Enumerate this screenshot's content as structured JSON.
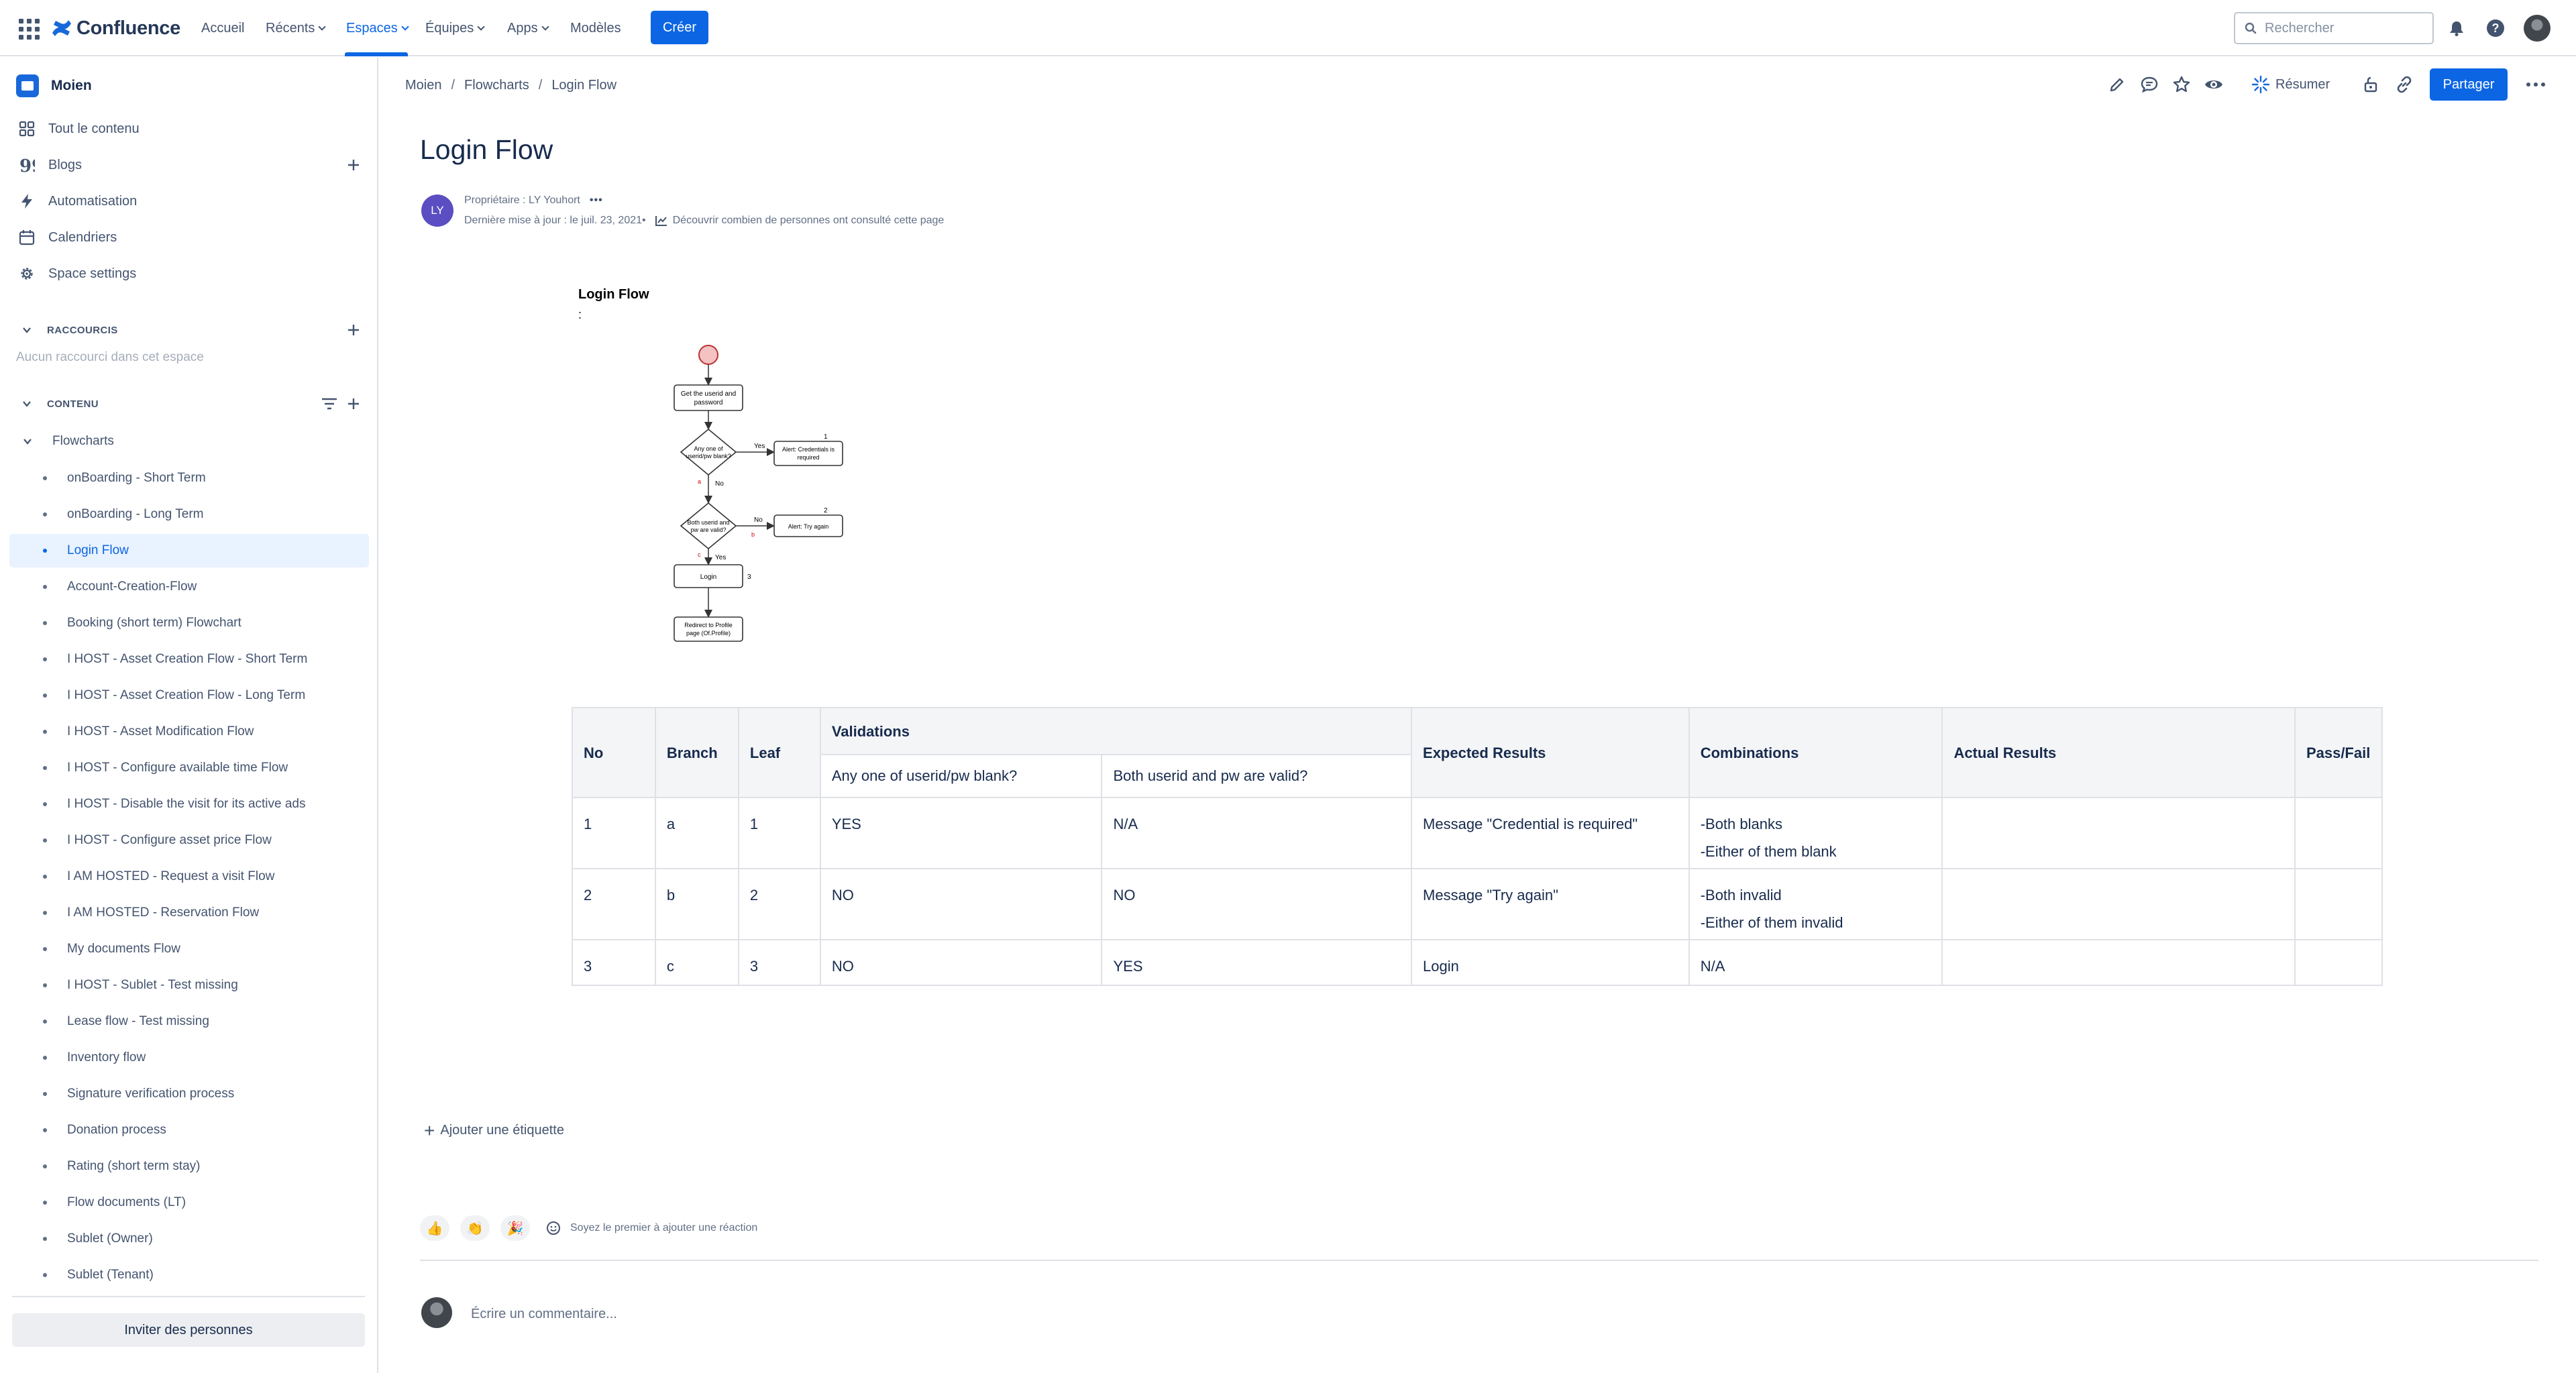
{
  "topnav": {
    "app_name": "Confluence",
    "items": [
      {
        "label": "Accueil",
        "has_chevron": false,
        "active": false
      },
      {
        "label": "Récents",
        "has_chevron": true,
        "active": false
      },
      {
        "label": "Espaces",
        "has_chevron": true,
        "active": true
      },
      {
        "label": "Équipes",
        "has_chevron": true,
        "active": false
      },
      {
        "label": "Apps",
        "has_chevron": true,
        "active": false
      },
      {
        "label": "Modèles",
        "has_chevron": false,
        "active": false
      }
    ],
    "create_label": "Créer",
    "search_placeholder": "Rechercher",
    "icons": [
      "app-switcher-icon",
      "notifications-icon",
      "help-icon",
      "profile-avatar"
    ]
  },
  "sidebar": {
    "space_name": "Moien",
    "links": [
      {
        "label": "Tout le contenu",
        "icon": "all-content-icon"
      },
      {
        "label": "Blogs",
        "icon": "quote-icon",
        "has_add": true
      },
      {
        "label": "Automatisation",
        "icon": "lightning-icon"
      },
      {
        "label": "Calendriers",
        "icon": "calendar-icon"
      },
      {
        "label": "Space settings",
        "icon": "gear-icon"
      }
    ],
    "shortcuts_heading": "RACCOURCIS",
    "shortcuts_empty": "Aucun raccourci dans cet espace",
    "content_heading": "CONTENU",
    "tree_parent": "Flowcharts",
    "tree_items": [
      "onBoarding - Short Term",
      "onBoarding - Long Term",
      "Login Flow",
      "Account-Creation-Flow",
      "Booking (short term) Flowchart",
      "I HOST - Asset Creation Flow - Short Term",
      "I HOST - Asset Creation Flow - Long Term",
      "I HOST - Asset Modification Flow",
      "I HOST - Configure available time Flow",
      "I HOST - Disable the visit for its active ads",
      "I HOST - Configure asset price Flow",
      "I AM HOSTED - Request a visit Flow",
      "I AM HOSTED - Reservation Flow",
      "My documents Flow",
      "I HOST - Sublet - Test missing",
      "Lease flow - Test missing",
      "Inventory flow",
      "Signature verification process",
      "Donation process",
      "Rating (short term stay)",
      "Flow documents (LT)",
      "Sublet (Owner)",
      "Sublet (Tenant)"
    ],
    "selected_item": "Login Flow",
    "invite_label": "Inviter des personnes"
  },
  "page": {
    "breadcrumb": [
      "Moien",
      "Flowcharts",
      "Login Flow"
    ],
    "toolbar": {
      "resume_label": "Résumer",
      "share_label": "Partager",
      "icons": [
        "edit-icon",
        "comment-icon",
        "star-icon",
        "watch-icon",
        "summary-icon",
        "restrictions-icon",
        "link-icon",
        "more-icon"
      ]
    },
    "title": "Login Flow",
    "byline": {
      "avatar_initials": "LY",
      "owner": "Propriétaire : LY Youhort",
      "last_updated": "Dernière mise à jour : le juil. 23, 2021•",
      "analytics_link": "Découvrir combien de personnes ont consulté cette page"
    },
    "diagram": {
      "title": "Login Flow",
      "colon": ":",
      "nodes": {
        "get_userid": [
          "Get the userid and",
          "password"
        ],
        "decision1": [
          "Any one of",
          "userid/pw blank?"
        ],
        "alert1": [
          "Alert: Credentials is",
          "required"
        ],
        "decision2": [
          "Both userid and",
          "pw are valid?"
        ],
        "alert2": "Alert: Try again",
        "login": "Login",
        "redirect": [
          "Redirect to Profile",
          "page (Of.Profile)"
        ]
      },
      "edge_labels": {
        "yes1": "Yes",
        "no1": "No",
        "no2": "No",
        "yes2": "Yes"
      },
      "step_numbers": {
        "n1": "1",
        "n2": "2",
        "n3": "3",
        "a": "a",
        "b": "b",
        "c": "c"
      }
    },
    "table": {
      "headers": [
        "No",
        "Branch",
        "Leaf",
        "Validations",
        "Expected Results",
        "Combinations",
        "Actual Results",
        "Pass/Fail"
      ],
      "subheaders": [
        "Any one of userid/pw blank?",
        "Both userid and pw are valid?"
      ],
      "rows": [
        {
          "no": "1",
          "branch": "a",
          "leaf": "1",
          "v1": "YES",
          "v2": "N/A",
          "expected": "Message \"Credential is required\"",
          "combinations": [
            "-Both blanks",
            "-Either of them blank"
          ],
          "actual": "",
          "pass": ""
        },
        {
          "no": "2",
          "branch": "b",
          "leaf": "2",
          "v1": "NO",
          "v2": "NO",
          "expected": "Message \"Try again\"",
          "combinations": [
            "-Both invalid",
            "-Either of them invalid"
          ],
          "actual": "",
          "pass": ""
        },
        {
          "no": "3",
          "branch": "c",
          "leaf": "3",
          "v1": "NO",
          "v2": "YES",
          "expected": "Login",
          "combinations": [
            "N/A"
          ],
          "actual": "",
          "pass": ""
        }
      ]
    },
    "add_label": "Ajouter une étiquette",
    "reactions": {
      "emojis": [
        "👍",
        "👏",
        "🎉"
      ],
      "prompt": "Soyez le premier à ajouter une réaction"
    },
    "comment_placeholder": "Écrire un commentaire..."
  },
  "colors": {
    "accent": "#0c66e4",
    "selected_bg": "#e9f2ff",
    "avatar_purple": "#5b4ec2",
    "diagram_start": "#f4c2c2"
  }
}
